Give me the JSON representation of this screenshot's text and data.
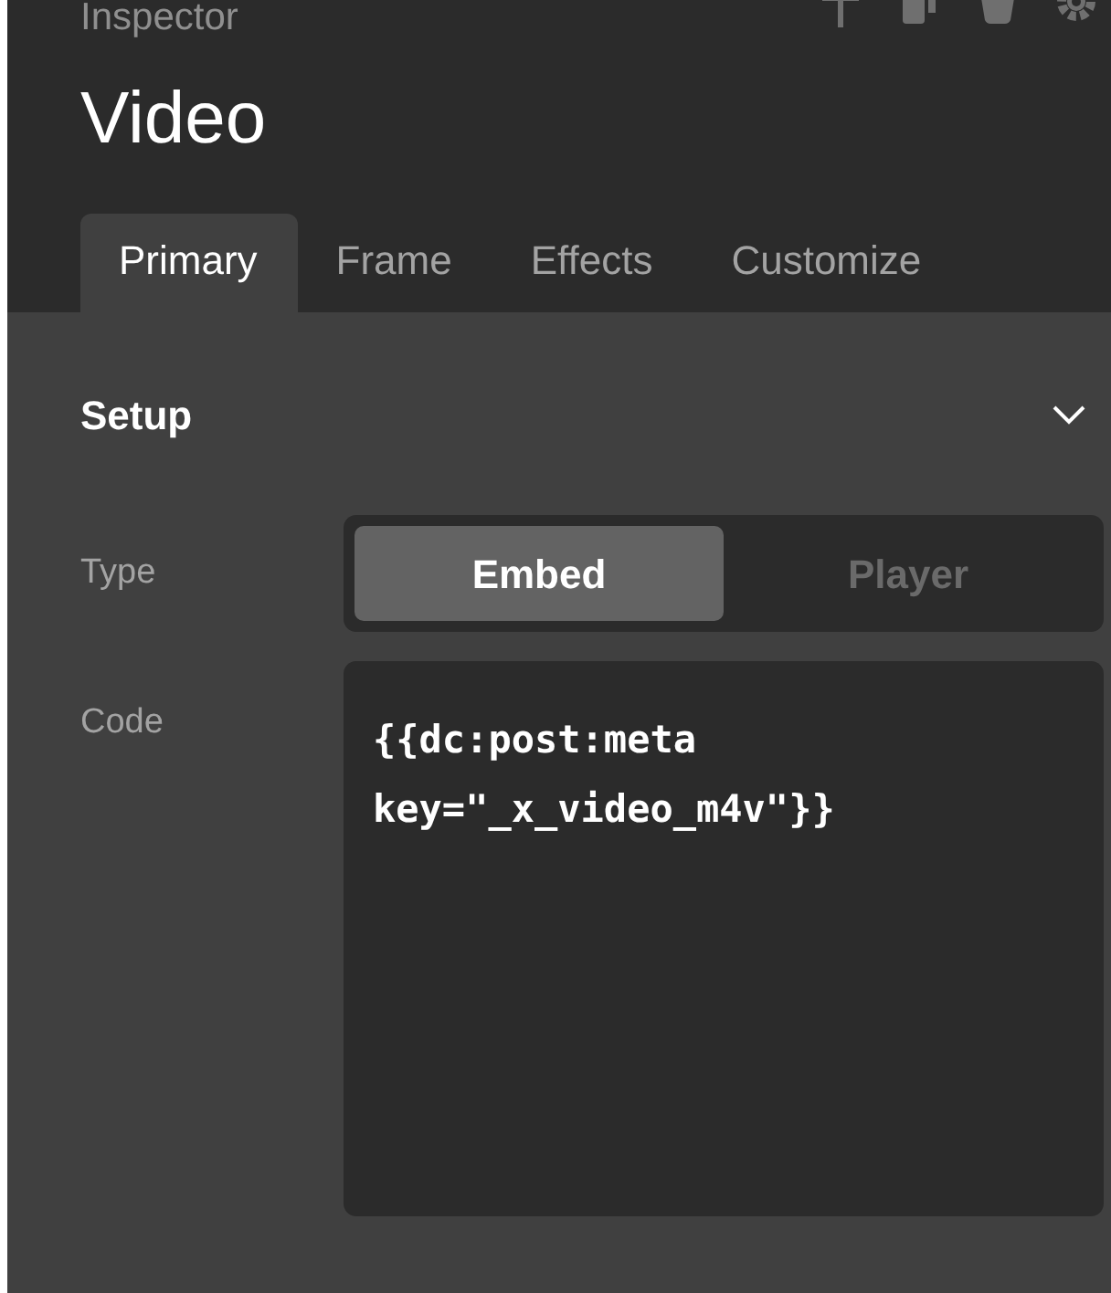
{
  "header": {
    "label": "Inspector",
    "title": "Video"
  },
  "tabs": [
    {
      "label": "Primary",
      "selected": true
    },
    {
      "label": "Frame",
      "selected": false
    },
    {
      "label": "Effects",
      "selected": false
    },
    {
      "label": "Customize",
      "selected": false
    }
  ],
  "section": {
    "title": "Setup",
    "expanded": true
  },
  "fields": [
    {
      "kind": "segmented",
      "label": "Type",
      "options": [
        {
          "label": "Embed",
          "selected": true
        },
        {
          "label": "Player",
          "selected": false
        }
      ]
    },
    {
      "kind": "code",
      "label": "Code",
      "value": "{{dc:post:meta key=\"_x_video_m4v\"}}"
    }
  ]
}
